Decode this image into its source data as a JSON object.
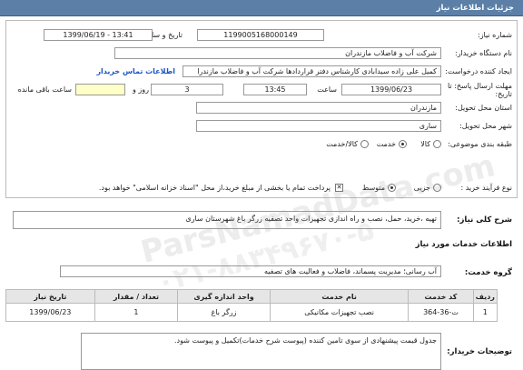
{
  "header": {
    "title": "جزئیات اطلاعات نیاز"
  },
  "form": {
    "need_number_label": "شماره نیاز:",
    "need_number": "1199005168000149",
    "announce_label": "تاریخ و ساعت اعلان عمومی:",
    "announce_value": "1399/06/19 - 13:41",
    "buyer_label": "نام دستگاه خریدار:",
    "buyer_value": "شرکت آب و فاضلاب مازندران",
    "creator_label": "ایجاد کننده درخواست:",
    "creator_value": "کمیل علی زاده سیدابادی کارشناس دفتر قراردادها شرکت آب و فاضلاب مازندرا",
    "contact_link": "اطلاعات تماس خریدار",
    "deadline_label": "مهلت ارسال پاسخ: تا تاریخ:",
    "deadline_date": "1399/06/23",
    "hour_label": "ساعت",
    "deadline_time": "13:45",
    "days_value": "3",
    "days_label": "روز و",
    "remaining_value": "",
    "remaining_label": "ساعت باقی مانده",
    "province_label": "استان محل تحویل:",
    "province_value": "مازندران",
    "city_label": "شهر محل تحویل:",
    "city_value": "ساری",
    "category_label": "طبقه بندی موضوعی:",
    "category_options": [
      "کالا",
      "خدمت",
      "کالا/خدمت"
    ],
    "category_selected": "خدمت",
    "process_label": "نوع فرآیند خرید :",
    "process_options": [
      "جزیی",
      "متوسط"
    ],
    "process_selected": "متوسط",
    "payment_note": "پرداخت تمام یا بخشی از مبلغ خرید،از محل \"اسناد خزانه اسلامی\" خواهد بود."
  },
  "summary": {
    "label": "شرح کلی نیاز:",
    "value": "تهیه ،خرید، حمل، نصب و راه اندازی تجهیزات واحد تصفیه زرگر باغ شهرستان ساری"
  },
  "goods_info_title": "اطلاعات خدمات مورد نیاز",
  "service_group": {
    "label": "گروه خدمت:",
    "value": "آب رسانی؛ مدیریت پسماند، فاضلاب و فعالیت های تصفیه"
  },
  "table": {
    "headers": [
      "ردیف",
      "کد خدمت",
      "نام خدمت",
      "واحد اندازه گیری",
      "تعداد / مقدار",
      "تاریخ نیاز"
    ],
    "rows": [
      [
        "1",
        "ت-36-364",
        "نصب تجهیزات مکانیکی",
        "زرگر باغ",
        "1",
        "1399/06/23"
      ]
    ]
  },
  "buyer_notes": {
    "label": "توضیحات خریدار:",
    "value": "جدول قیمت پیشنهادی از سوی تامین کننده (پیوست شرح خدمات)تکمیل و پیوست شود."
  },
  "watermark": {
    "line1": "ParsNamadData.com",
    "line2": "۰۲۱-۸۸۳۴۹۶۷۰-۵"
  }
}
